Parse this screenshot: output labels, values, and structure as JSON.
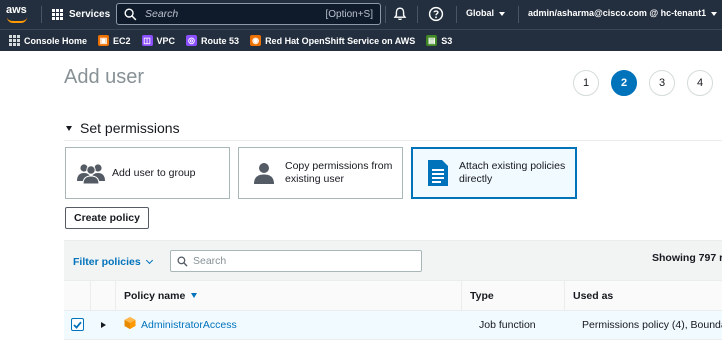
{
  "nav": {
    "logo": "aws",
    "services_label": "Services",
    "search_placeholder": "Search",
    "search_shortcut": "[Option+S]",
    "region_label": "Global",
    "account_label": "admin/asharma@cisco.com @ hc-tenant1"
  },
  "favorites": [
    {
      "label": "Console Home",
      "icon": "console-home-icon",
      "color": "#232f3e"
    },
    {
      "label": "EC2",
      "icon": "ec2-icon",
      "color": "#ed7100"
    },
    {
      "label": "VPC",
      "icon": "vpc-icon",
      "color": "#8c4fff"
    },
    {
      "label": "Route 53",
      "icon": "route53-icon",
      "color": "#8c4fff"
    },
    {
      "label": "Red Hat OpenShift Service on AWS",
      "icon": "openshift-icon",
      "color": "#ed7100"
    },
    {
      "label": "S3",
      "icon": "s3-icon",
      "color": "#3f8624"
    }
  ],
  "page": {
    "title": "Add user",
    "steps": [
      "1",
      "2",
      "3",
      "4"
    ],
    "active_step": "2"
  },
  "permissions": {
    "section_title": "Set permissions",
    "options": [
      {
        "label": "Add user to group",
        "icon": "group-icon",
        "selected": false
      },
      {
        "label": "Copy permissions from existing user",
        "icon": "user-icon",
        "selected": false
      },
      {
        "label": "Attach existing policies directly",
        "icon": "document-icon",
        "selected": true
      }
    ],
    "create_policy_label": "Create policy"
  },
  "filter": {
    "dropdown_label": "Filter policies",
    "search_placeholder": "Search",
    "showing_text": "Showing 797 r"
  },
  "table": {
    "columns": [
      "Policy name",
      "Type",
      "Used as"
    ],
    "rows": [
      {
        "checked": true,
        "name": "AdministratorAccess",
        "type": "Job function",
        "used_as": "Permissions policy (4), Bounda"
      }
    ]
  },
  "colors": {
    "nav_bg": "#232f3e",
    "accent": "#0073bb",
    "selected_bg": "#f1faff",
    "policy_icon": "#ff9900"
  }
}
